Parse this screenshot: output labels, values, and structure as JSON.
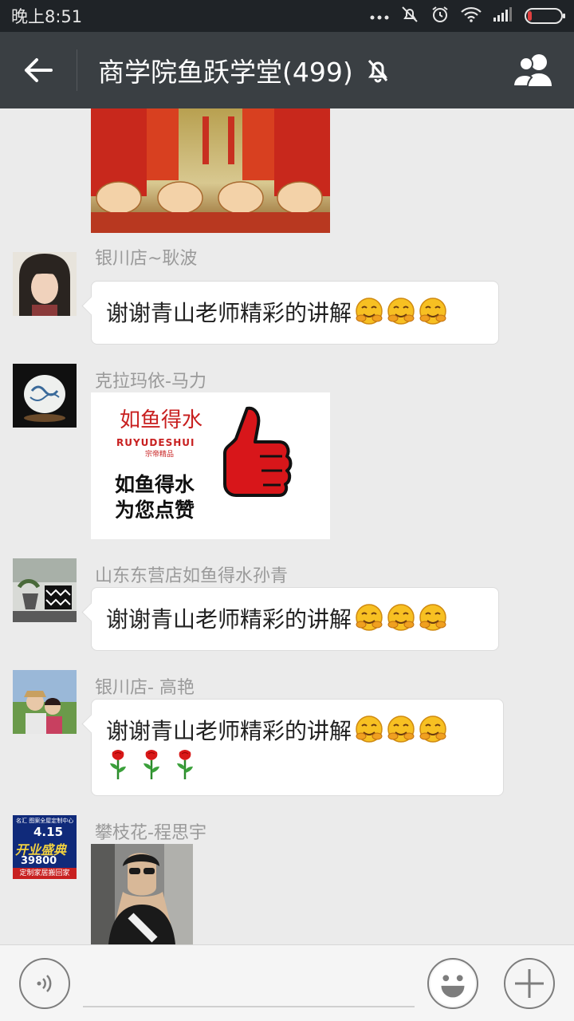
{
  "status_bar": {
    "time": "晚上8:51",
    "icons": [
      "more-dots-icon",
      "alarm-off-icon",
      "alarm-clock-icon",
      "wifi-icon",
      "signal-icon",
      "battery-icon"
    ],
    "battery_level": 0.12,
    "battery_color": "#e04040"
  },
  "header": {
    "title": "商学院鱼跃学堂(499)",
    "icons": [
      "back-arrow-icon",
      "mute-bell-icon",
      "group-members-icon"
    ]
  },
  "messages": [
    {
      "type": "image",
      "description_icon": "applause-image"
    },
    {
      "type": "text",
      "sender": "银川店~耿波",
      "text": "谢谢青山老师精彩的讲解",
      "emoji": [
        "hugging-face-icon",
        "hugging-face-icon",
        "hugging-face-icon"
      ]
    },
    {
      "type": "image",
      "sender": "克拉玛依-马力",
      "logo_cn": "如鱼得水",
      "logo_en": "RUYUDESHUI",
      "logo_sub": "宗帝精品",
      "caption_line1": "如鱼得水",
      "caption_line2": "为您点赞"
    },
    {
      "type": "text",
      "sender": "山东东营店如鱼得水孙青",
      "text": "谢谢青山老师精彩的讲解",
      "emoji": [
        "hugging-face-icon",
        "hugging-face-icon",
        "hugging-face-icon"
      ]
    },
    {
      "type": "text",
      "sender": "银川店- 高艳",
      "text": "谢谢青山老师精彩的讲解",
      "emoji": [
        "hugging-face-icon",
        "hugging-face-icon",
        "hugging-face-icon"
      ],
      "extra_emoji": [
        "rose-icon",
        "rose-icon",
        "rose-icon"
      ]
    },
    {
      "type": "image",
      "sender": "攀枝花-程思宇",
      "avatar_text_1": "名汇 图案全屋定制中心",
      "avatar_text_2": "4.15",
      "avatar_text_3": "开业盛典",
      "avatar_text_4": "39800",
      "avatar_text_5": "定制家居搬回家"
    }
  ],
  "input_bar": {
    "icons": [
      "voice-icon",
      "emoji-face-icon",
      "plus-icon"
    ],
    "placeholder": ""
  }
}
